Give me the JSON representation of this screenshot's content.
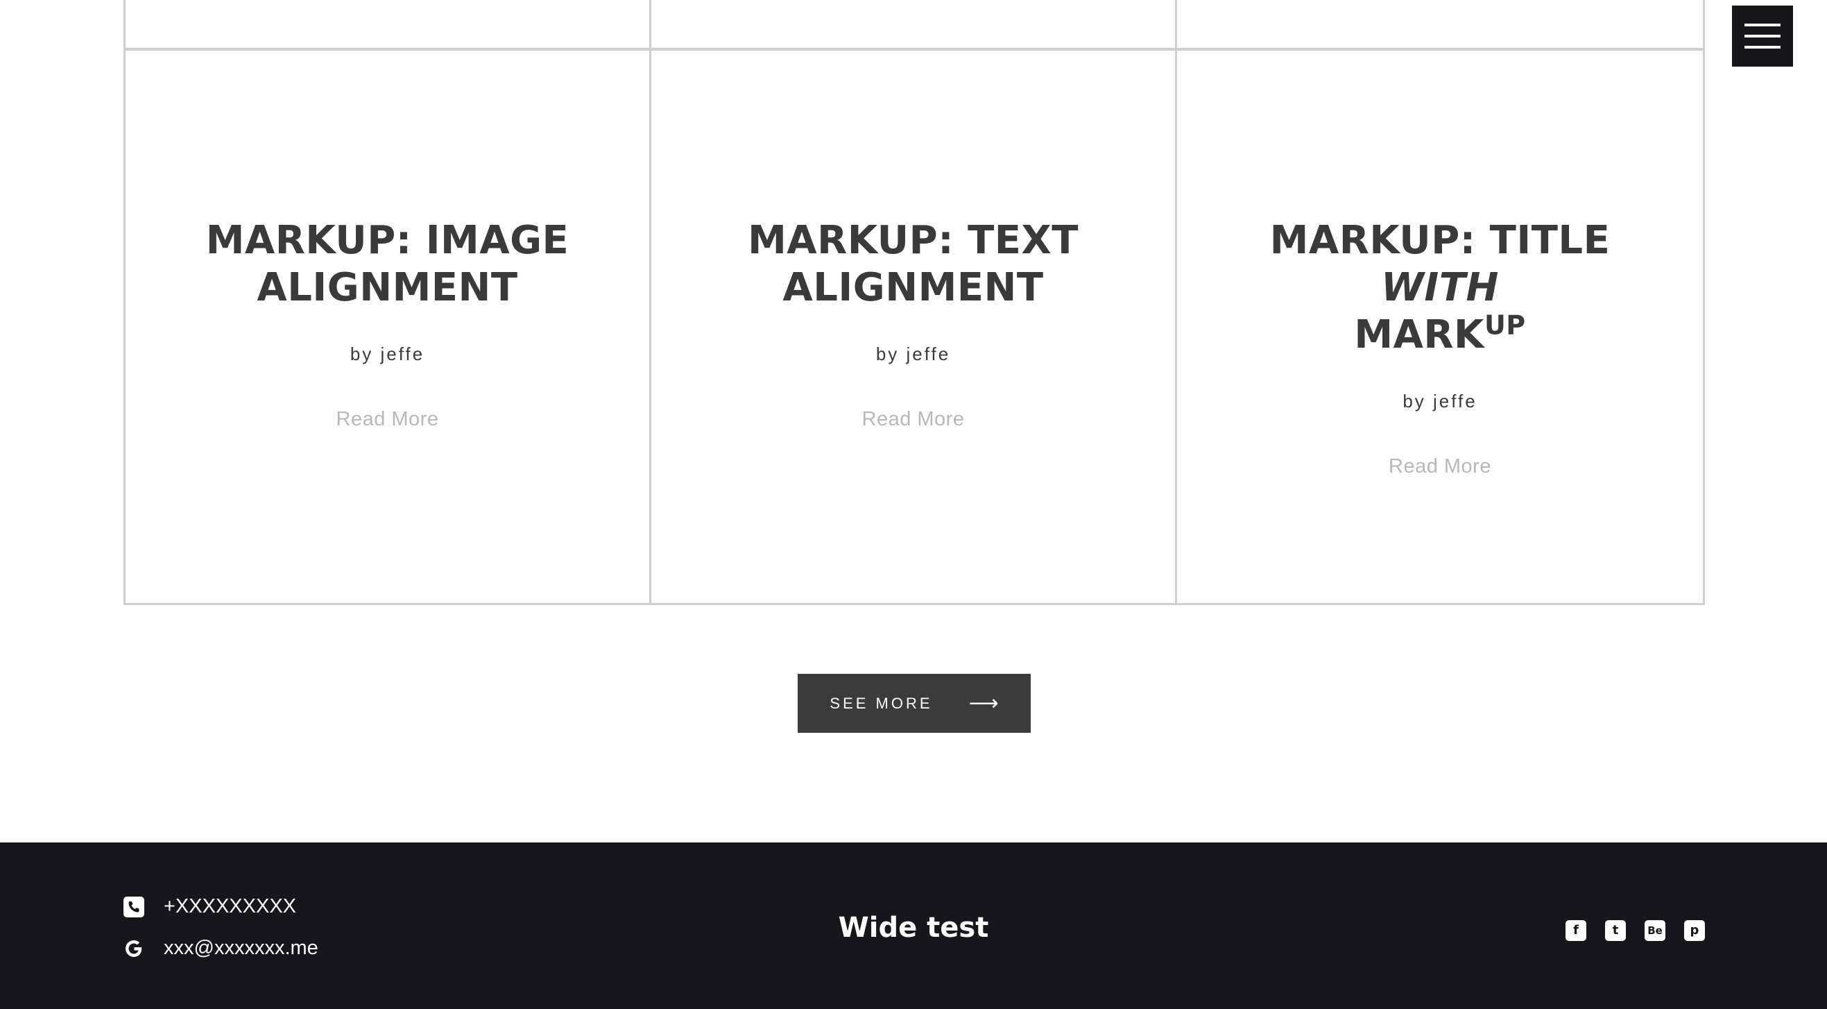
{
  "posts": [
    {
      "title_main": "MARKUP: IMAGE ALIGNMENT",
      "author": "by jeffe",
      "read_more": "Read More"
    },
    {
      "title_main": "MARKUP: TEXT ALIGNMENT",
      "author": "by jeffe",
      "read_more": "Read More"
    },
    {
      "title_part1": "MARKUP: TITLE ",
      "title_em": "WITH",
      "title_part2": "MARK",
      "title_sup": "UP",
      "author": "by jeffe",
      "read_more": "Read More"
    }
  ],
  "see_more": {
    "label": "SEE MORE",
    "arrow": "⟶"
  },
  "footer": {
    "phone": "+XXXXXXXXX",
    "email": "xxx@xxxxxxx.me",
    "site_title": "Wide test",
    "social": [
      {
        "icon": "facebook-icon",
        "glyph": "f"
      },
      {
        "icon": "twitter-icon",
        "glyph": "t"
      },
      {
        "icon": "behance-icon",
        "glyph": "Be"
      },
      {
        "icon": "pinterest-icon",
        "glyph": "p"
      }
    ]
  },
  "colors": {
    "footer_bg": "#17161c",
    "button_bg": "#3b3b3c",
    "text_dark": "#3a3a3a",
    "read_more": "#b8b8b8",
    "border": "#cfcfcf"
  }
}
